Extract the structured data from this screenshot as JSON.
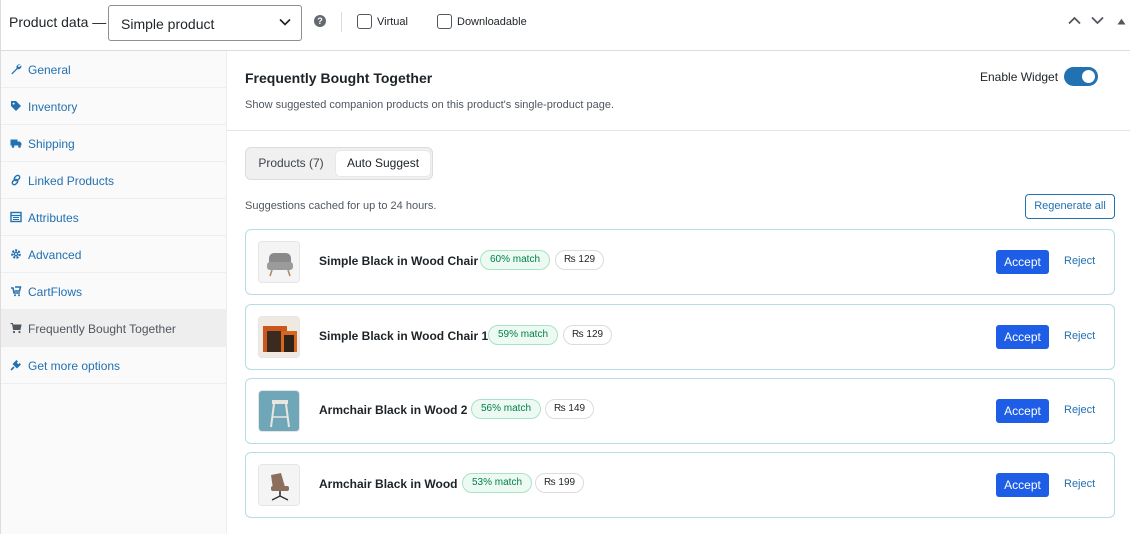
{
  "header": {
    "title": "Product data —",
    "product_type": "Simple product",
    "help": "?",
    "virtual_label": "Virtual",
    "downloadable_label": "Downloadable"
  },
  "sidebar": {
    "items": [
      {
        "label": "General",
        "icon": "wrench-icon"
      },
      {
        "label": "Inventory",
        "icon": "tag-icon"
      },
      {
        "label": "Shipping",
        "icon": "truck-icon"
      },
      {
        "label": "Linked Products",
        "icon": "link-icon"
      },
      {
        "label": "Attributes",
        "icon": "table-icon"
      },
      {
        "label": "Advanced",
        "icon": "gear-icon"
      },
      {
        "label": "CartFlows",
        "icon": "cartflows-icon"
      },
      {
        "label": "Frequently Bought Together",
        "icon": "cart-icon"
      },
      {
        "label": "Get more options",
        "icon": "plugin-icon"
      }
    ],
    "active_index": 7
  },
  "section": {
    "title": "Frequently Bought Together",
    "description": "Show suggested companion products on this product's single-product page.",
    "toggle_label": "Enable Widget",
    "toggle_on": true
  },
  "tabs": {
    "products_label": "Products (7)",
    "auto_label": "Auto Suggest"
  },
  "cache_note": "Suggestions cached for up to 24 hours.",
  "regenerate_label": "Regenerate all",
  "suggestions": [
    {
      "name": "Simple Black in Wood Chair",
      "match": "60% match",
      "price": "₨ 129",
      "thumb": "armchair-thumb"
    },
    {
      "name": "Simple Black in Wood Chair 1",
      "match": "59% match",
      "price": "₨ 129",
      "thumb": "nesting-tables-thumb"
    },
    {
      "name": "Armchair Black in Wood 2",
      "match": "56% match",
      "price": "₨ 149",
      "thumb": "stool-thumb"
    },
    {
      "name": "Armchair Black in Wood",
      "match": "53% match",
      "price": "₨ 199",
      "thumb": "lounge-chair-thumb"
    }
  ],
  "actions": {
    "accept": "Accept",
    "reject": "Reject"
  },
  "colors": {
    "accent": "#2271b1",
    "accept_bg": "#1e5ee6",
    "match_text": "#00804a",
    "card_border": "#b6dce8"
  }
}
